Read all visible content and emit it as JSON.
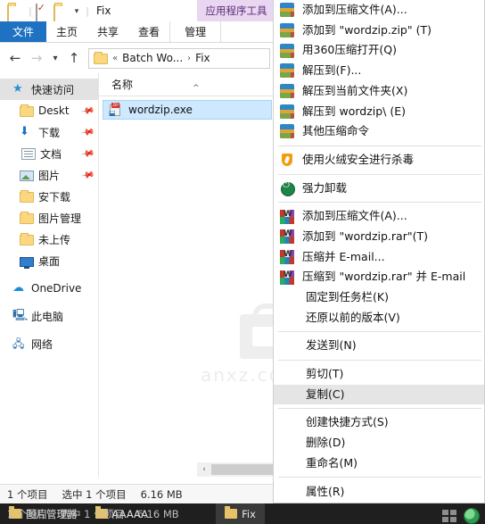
{
  "window": {
    "title": "Fix",
    "contextual_tab": "应用程序工具",
    "quick_access": {
      "folder_icon": "folder-icon",
      "properties_icon": "properties-icon",
      "new_folder_icon": "new-folder-icon",
      "customize_caret": "chevron-down-icon"
    },
    "tabs": [
      {
        "label": "文件",
        "state": "active-file"
      },
      {
        "label": "主页",
        "state": "normal"
      },
      {
        "label": "共享",
        "state": "normal"
      },
      {
        "label": "查看",
        "state": "normal"
      },
      {
        "label": "管理",
        "state": "contextual"
      }
    ]
  },
  "address_bar": {
    "back_icon": "arrow-left-icon",
    "forward_icon": "arrow-right-icon",
    "recent_icon": "chevron-down-icon",
    "up_icon": "arrow-up-icon",
    "folder_icon": "folder-icon",
    "overflow": "«",
    "crumbs": [
      "Batch Wo...",
      "Fix"
    ],
    "separator": "›"
  },
  "sidebar": {
    "items": [
      {
        "label": "快速访问",
        "icon": "star-pin-icon",
        "selected": true,
        "indent": false,
        "pinned": false,
        "group": false
      },
      {
        "label": "Deskt",
        "icon": "folder-icon",
        "selected": false,
        "indent": true,
        "pinned": true,
        "group": false
      },
      {
        "label": "下载",
        "icon": "download-icon",
        "selected": false,
        "indent": true,
        "pinned": true,
        "group": false
      },
      {
        "label": "文档",
        "icon": "document-icon",
        "selected": false,
        "indent": true,
        "pinned": true,
        "group": false
      },
      {
        "label": "图片",
        "icon": "picture-icon",
        "selected": false,
        "indent": true,
        "pinned": true,
        "group": false
      },
      {
        "label": "安下载",
        "icon": "folder-icon",
        "selected": false,
        "indent": true,
        "pinned": false,
        "group": false
      },
      {
        "label": "图片管理",
        "icon": "folder-icon",
        "selected": false,
        "indent": true,
        "pinned": false,
        "group": false
      },
      {
        "label": "未上传",
        "icon": "folder-icon",
        "selected": false,
        "indent": true,
        "pinned": false,
        "group": false
      },
      {
        "label": "桌面",
        "icon": "desktop-icon",
        "selected": false,
        "indent": true,
        "pinned": false,
        "group": false
      },
      {
        "label": "OneDrive",
        "icon": "cloud-icon",
        "selected": false,
        "indent": false,
        "pinned": false,
        "group": true
      },
      {
        "label": "此电脑",
        "icon": "this-pc-icon",
        "selected": false,
        "indent": false,
        "pinned": false,
        "group": true
      },
      {
        "label": "网络",
        "icon": "network-icon",
        "selected": false,
        "indent": false,
        "pinned": false,
        "group": true
      }
    ]
  },
  "file_list": {
    "column_header": "名称",
    "sort_caret": "chevron-up-icon",
    "rows": [
      {
        "name": "wordzip.exe",
        "icon": "zip-exe-icon",
        "selected": true
      }
    ]
  },
  "scrollbar": {
    "left_arrow": "‹",
    "right_arrow": "›"
  },
  "status_bar": {
    "items_count": "1 个项目",
    "selection": "选中 1 个项目",
    "size": "6.16 MB"
  },
  "context_menu": {
    "items": [
      {
        "label": "添加到压缩文件(A)...",
        "icon": "360zip-icon",
        "type": "item",
        "hover": false
      },
      {
        "label": "添加到 \"wordzip.zip\" (T)",
        "icon": "360zip-icon",
        "type": "item",
        "hover": false
      },
      {
        "label": "用360压缩打开(Q)",
        "icon": "360zip-icon",
        "type": "item",
        "hover": false
      },
      {
        "label": "解压到(F)...",
        "icon": "360zip-icon",
        "type": "item",
        "hover": false
      },
      {
        "label": "解压到当前文件夹(X)",
        "icon": "360zip-icon",
        "type": "item",
        "hover": false
      },
      {
        "label": "解压到 wordzip\\ (E)",
        "icon": "360zip-icon",
        "type": "item",
        "hover": false
      },
      {
        "label": "其他压缩命令",
        "icon": "360zip-icon",
        "type": "item",
        "hover": false
      },
      {
        "label": "",
        "icon": "",
        "type": "separator",
        "hover": false
      },
      {
        "label": "使用火绒安全进行杀毒",
        "icon": "huorong-icon",
        "type": "item",
        "hover": false
      },
      {
        "label": "",
        "icon": "",
        "type": "separator",
        "hover": false
      },
      {
        "label": "强力卸载",
        "icon": "uninstall-icon",
        "type": "item",
        "hover": false
      },
      {
        "label": "",
        "icon": "",
        "type": "separator",
        "hover": false
      },
      {
        "label": "添加到压缩文件(A)...",
        "icon": "winrar-icon",
        "type": "item",
        "hover": false
      },
      {
        "label": "添加到 \"wordzip.rar\"(T)",
        "icon": "winrar-icon",
        "type": "item",
        "hover": false
      },
      {
        "label": "压缩并 E-mail...",
        "icon": "winrar-icon",
        "type": "item",
        "hover": false
      },
      {
        "label": "压缩到 \"wordzip.rar\" 并 E-mail",
        "icon": "winrar-icon",
        "type": "item",
        "hover": false
      },
      {
        "label": "固定到任务栏(K)",
        "icon": "",
        "type": "item",
        "hover": false
      },
      {
        "label": "还原以前的版本(V)",
        "icon": "",
        "type": "item",
        "hover": false
      },
      {
        "label": "",
        "icon": "",
        "type": "separator",
        "hover": false
      },
      {
        "label": "发送到(N)",
        "icon": "",
        "type": "item",
        "hover": false
      },
      {
        "label": "",
        "icon": "",
        "type": "separator",
        "hover": false
      },
      {
        "label": "剪切(T)",
        "icon": "",
        "type": "item",
        "hover": false
      },
      {
        "label": "复制(C)",
        "icon": "",
        "type": "item",
        "hover": true
      },
      {
        "label": "",
        "icon": "",
        "type": "separator",
        "hover": false
      },
      {
        "label": "创建快捷方式(S)",
        "icon": "",
        "type": "item",
        "hover": false
      },
      {
        "label": "删除(D)",
        "icon": "",
        "type": "item",
        "hover": false
      },
      {
        "label": "重命名(M)",
        "icon": "",
        "type": "item",
        "hover": false
      },
      {
        "label": "",
        "icon": "",
        "type": "separator",
        "hover": false
      },
      {
        "label": "属性(R)",
        "icon": "",
        "type": "item",
        "hover": false
      }
    ]
  },
  "watermark": {
    "text": "anxz.com",
    "icon": "shopping-bag-icon"
  },
  "taskbar": {
    "items": [
      {
        "label": "图片管理器",
        "icon": "folder-icon",
        "active": false
      },
      {
        "label": "AAAAA",
        "icon": "folder-icon",
        "active": false
      },
      {
        "label": "Fix",
        "icon": "folder-icon",
        "active": true
      }
    ],
    "tray": {
      "grid_icon": "task-view-icon",
      "globe_icon": "browser-icon"
    }
  },
  "colors": {
    "accent": "#1f72c1",
    "contextual_tab": "#e9d7f2",
    "selection": "#cde8ff",
    "menu_hover": "#e5e5e5",
    "taskbar": "#1f1f1f"
  }
}
